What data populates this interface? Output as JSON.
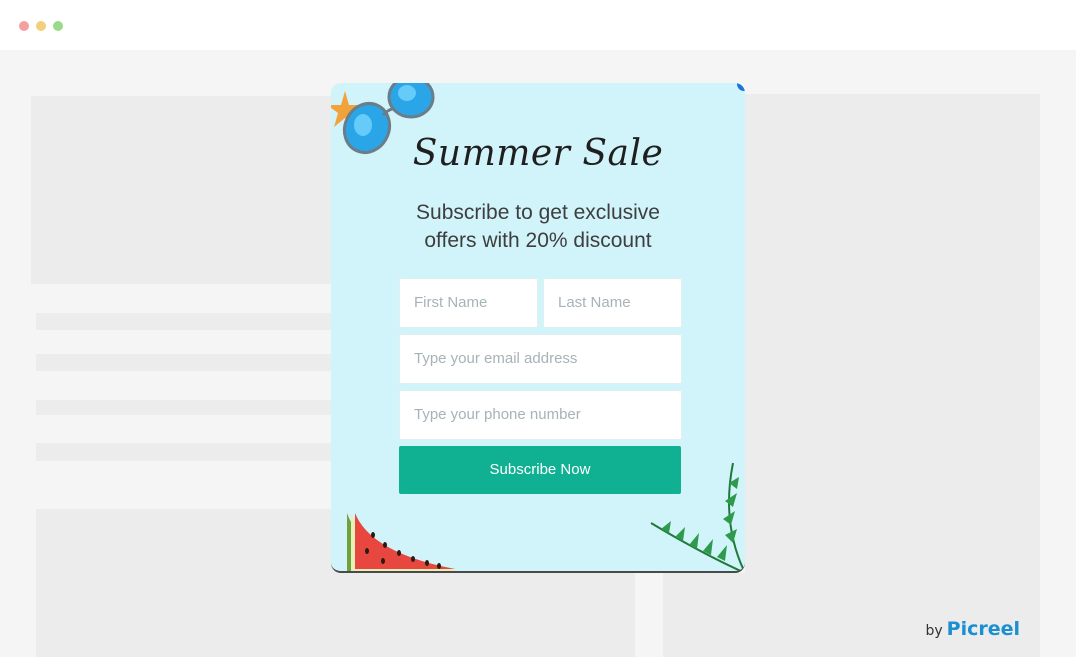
{
  "popup": {
    "title": "Summer Sale",
    "subtitle": "Subscribe to get exclusive offers with 20% discount",
    "fields": {
      "first_name_placeholder": "First Name",
      "last_name_placeholder": "Last Name",
      "email_placeholder": "Type your email address",
      "phone_placeholder": "Type your phone number"
    },
    "submit_label": "Subscribe Now"
  },
  "branding": {
    "by": "by",
    "name": "Picreel"
  },
  "colors": {
    "popup_bg": "#d1f4fb",
    "button": "#10b192",
    "brand": "#1a8fd1"
  },
  "decorations": [
    "starfish-icon",
    "sunglasses-icon",
    "watermelon-icon",
    "palm-leaf-icon"
  ]
}
